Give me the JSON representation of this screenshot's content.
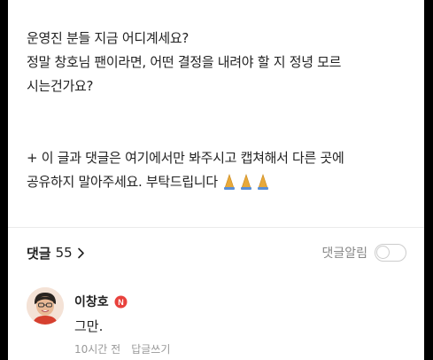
{
  "post": {
    "line1": "운영진 분들 지금 어디계세요?",
    "line2": "정말 창호님 팬이라면, 어떤 결정을 내려야 할 지 정녕 모르",
    "line3": "시는건가요?",
    "notice_line1": "+ 이 글과 댓글은 여기에서만 봐주시고 캡쳐해서 다른 곳에",
    "notice_line2": "공유하지 말아주세요. 부탁드립니다",
    "notice_emoji_name": "folded-hands-icon"
  },
  "comments_header": {
    "label": "댓글",
    "count": "55",
    "alarm_label": "댓글알림",
    "alarm_on": false
  },
  "comment": {
    "author": "이창호",
    "badge_letter": "N",
    "badge_color": "#e8413c",
    "text": "그만.",
    "time": "10시간 전",
    "reply_label": "답글쓰기"
  },
  "colors": {
    "text": "#222222",
    "muted": "#999999",
    "divider": "#ebebeb",
    "pray": "#e8a93a"
  }
}
